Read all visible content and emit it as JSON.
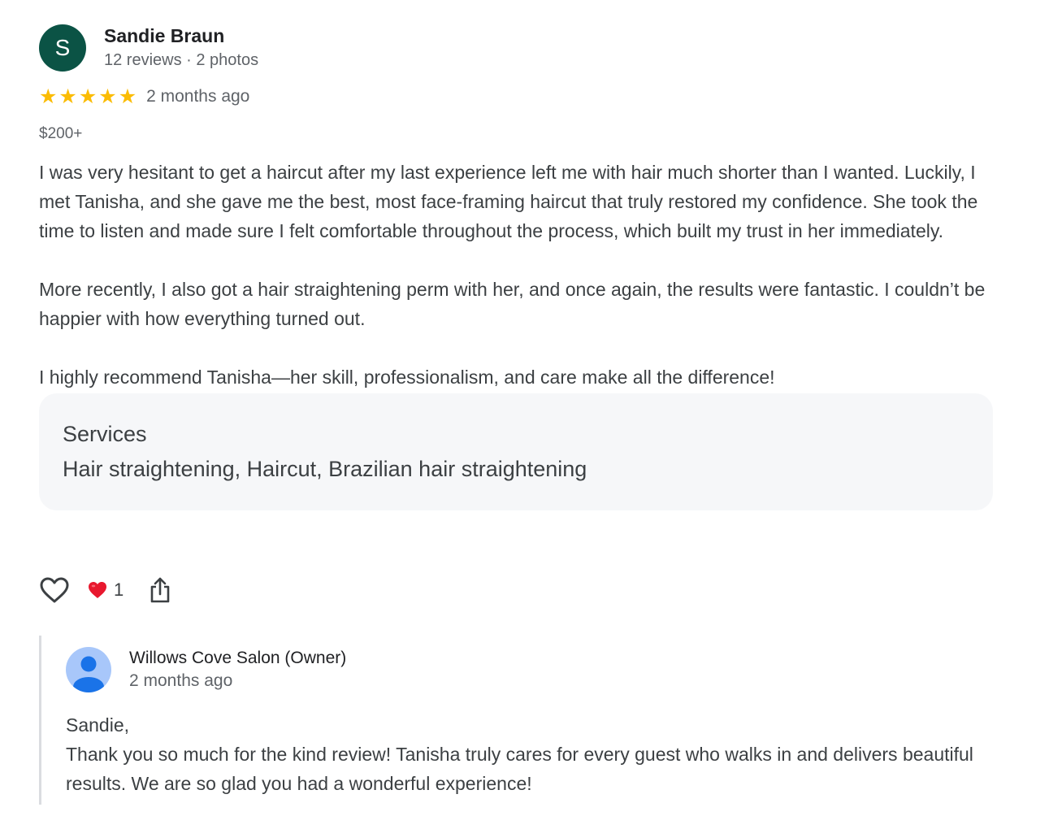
{
  "review": {
    "avatar_letter": "S",
    "author": "Sandie Braun",
    "meta": "12 reviews · 2 photos",
    "rating": 5,
    "star_glyph": "★",
    "time": "2 months ago",
    "price": "$200+",
    "paragraphs": [
      "I was very hesitant to get a haircut after my last experience left me with hair much shorter than I wanted. Luckily, I met Tanisha, and she gave me the best, most face-framing haircut that truly restored my confidence. She took the time to listen and made sure I felt comfortable throughout the process, which built my trust in her immediately.",
      "More recently, I also got a hair straightening perm with her, and once again, the results were fantastic. I couldn’t be happier with how everything turned out.",
      "I highly recommend Tanisha—her skill, professionalism, and care make all the difference!"
    ],
    "services": {
      "title": "Services",
      "list": "Hair straightening, Haircut, Brazilian hair straightening"
    }
  },
  "actions": {
    "like_icon": "heart-outline-icon",
    "reaction_icon": "red-heart-icon",
    "reaction_count": "1",
    "share_icon": "share-icon"
  },
  "reply": {
    "owner": "Willows Cove Salon (Owner)",
    "time": "2 months ago",
    "lines": [
      "Sandie,",
      "Thank you so much for the kind review! Tanisha truly cares for every guest who walks in and delivers beautiful results. We are so glad you had a wonderful experience!"
    ]
  },
  "colors": {
    "avatar_bg": "#0b5345",
    "star": "#fbbc04",
    "reaction_heart": "#e8182e",
    "services_bg": "#f6f7f9",
    "owner_avatar_bg": "#a8c7fa",
    "owner_avatar_fg": "#1a73e8"
  }
}
